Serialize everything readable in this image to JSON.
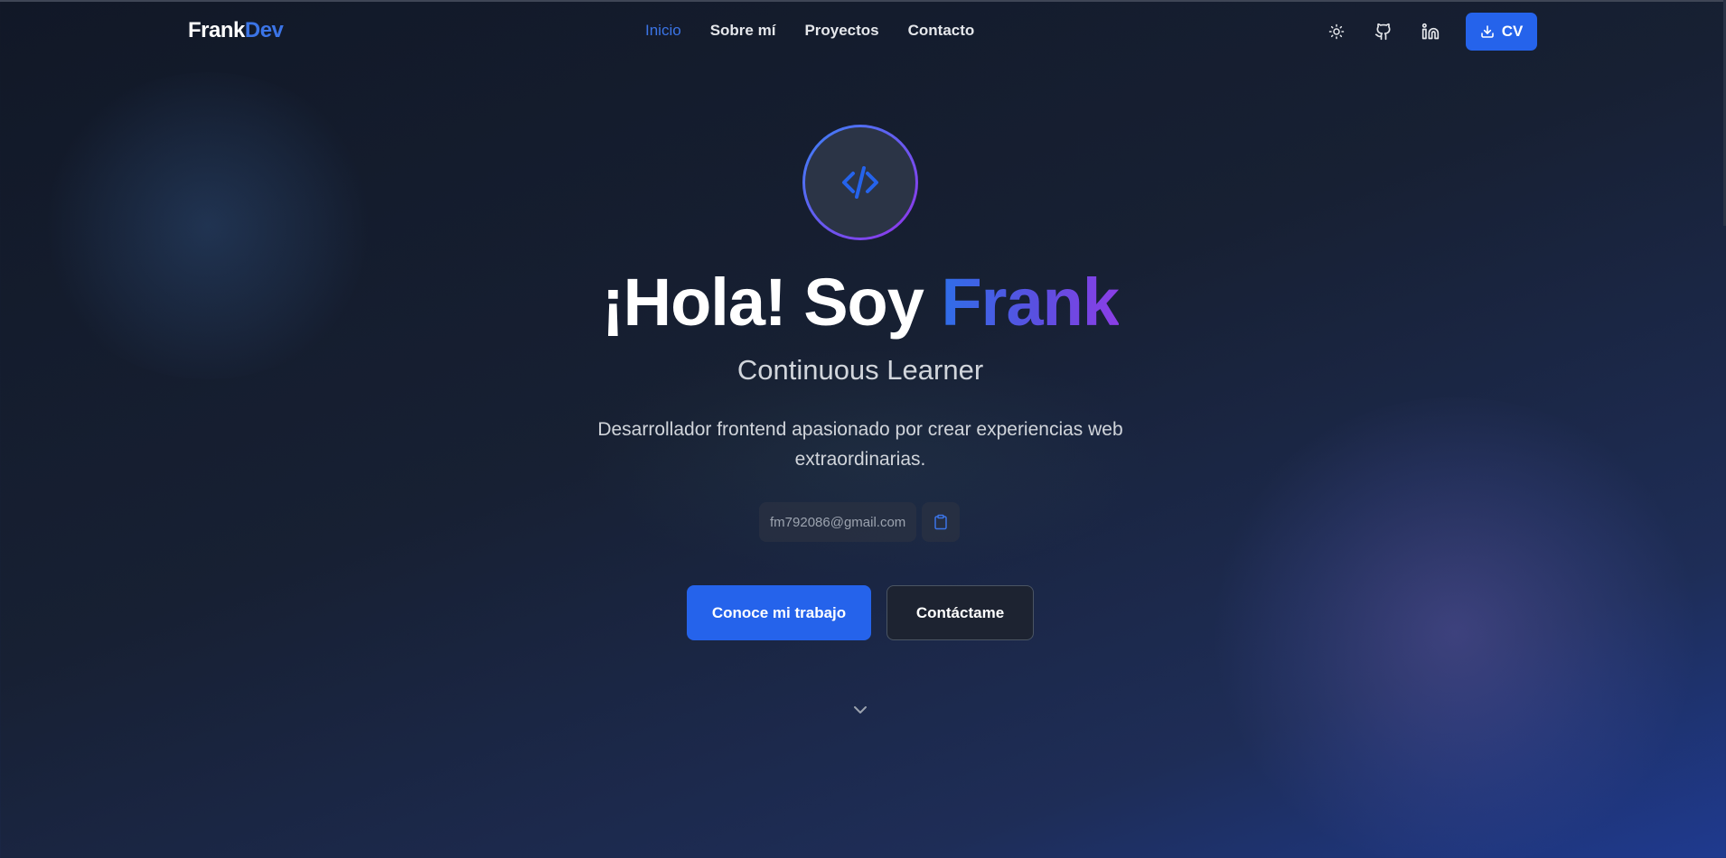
{
  "navbar": {
    "logo": {
      "part1": "Frank",
      "part2": "Dev"
    },
    "links": [
      {
        "label": "Inicio",
        "active": true
      },
      {
        "label": "Sobre mí",
        "active": false
      },
      {
        "label": "Proyectos",
        "active": false
      },
      {
        "label": "Contacto",
        "active": false
      }
    ],
    "icons": [
      "sun-icon",
      "github-icon",
      "linkedin-icon"
    ],
    "cv_button": {
      "label": "CV",
      "icon": "download-icon"
    }
  },
  "hero": {
    "avatar_icon": "code-icon",
    "title_prefix": "¡Hola! Soy",
    "title_name": "Frank",
    "subtitle": "Continuous Learner",
    "description": "Desarrollador frontend apasionado por crear experiencias web extraordinarias.",
    "email": "fm792086@gmail.com",
    "copy_icon": "clipboard-icon",
    "primary_button": "Conoce mi trabajo",
    "secondary_button": "Contáctame",
    "scroll_icon": "chevron-down-icon"
  },
  "colors": {
    "accent": "#2563eb",
    "gradient_start": "#3b82f6",
    "gradient_end": "#9333ea",
    "background": "#111827"
  }
}
